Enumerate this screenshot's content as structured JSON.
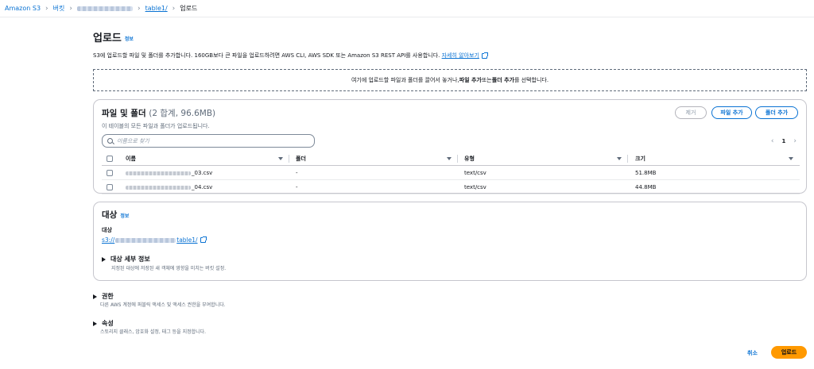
{
  "breadcrumb": {
    "items": [
      "Amazon S3",
      "버킷",
      "table1/",
      "업로드"
    ]
  },
  "page": {
    "title": "업로드",
    "info": "정보",
    "description": "S3에 업로드할 파일 및 폴더를 추가합니다. 160GB보다 큰 파일을 업로드하려면 AWS CLI, AWS SDK 또는 Amazon S3 REST API를 사용합니다.",
    "learn_more": "자세히 알아보기"
  },
  "dropzone": {
    "before": "여기에 업로드할 파일과 폴더를 끌어서 놓거나, ",
    "bold1": "파일 추가",
    "middle": " 또는 ",
    "bold2": "폴더 추가",
    "after": "를 선택합니다."
  },
  "files_panel": {
    "title": "파일 및 폴더",
    "count": "(2 합계, 96.6MB)",
    "subtitle": "이 테이블의 모든 파일과 폴더가 업로드됩니다.",
    "remove_label": "제거",
    "add_files_label": "파일 추가",
    "add_folder_label": "폴더 추가",
    "search_placeholder": "이름으로 찾기",
    "page_number": "1",
    "columns": [
      "이름",
      "폴더",
      "유형",
      "크기"
    ],
    "rows": [
      {
        "name_suffix": "_03.csv",
        "folder": "-",
        "type": "text/csv",
        "size": "51.8MB"
      },
      {
        "name_suffix": "_04.csv",
        "folder": "-",
        "type": "text/csv",
        "size": "44.8MB"
      }
    ]
  },
  "destination": {
    "title": "대상",
    "info": "정보",
    "label": "대상",
    "path_prefix": "s3://",
    "path_suffix": "table1/",
    "details_title": "대상 세부 정보",
    "details_sub": "지정된 대상에 저장된 새 객체에 영향을 미치는 버킷 설정."
  },
  "permissions": {
    "title": "권한",
    "sub": "다른 AWS 계정에 퍼블릭 액세스 및 액세스 권한을 부여합니다."
  },
  "properties": {
    "title": "속성",
    "sub": "스토리지 클래스, 암호화 설정, 태그 등을 지정합니다."
  },
  "footer": {
    "cancel_label": "취소",
    "upload_label": "업로드"
  },
  "colors": {
    "link": "#0972d3",
    "primary_button": "#ff9900",
    "text": "#16191f"
  }
}
